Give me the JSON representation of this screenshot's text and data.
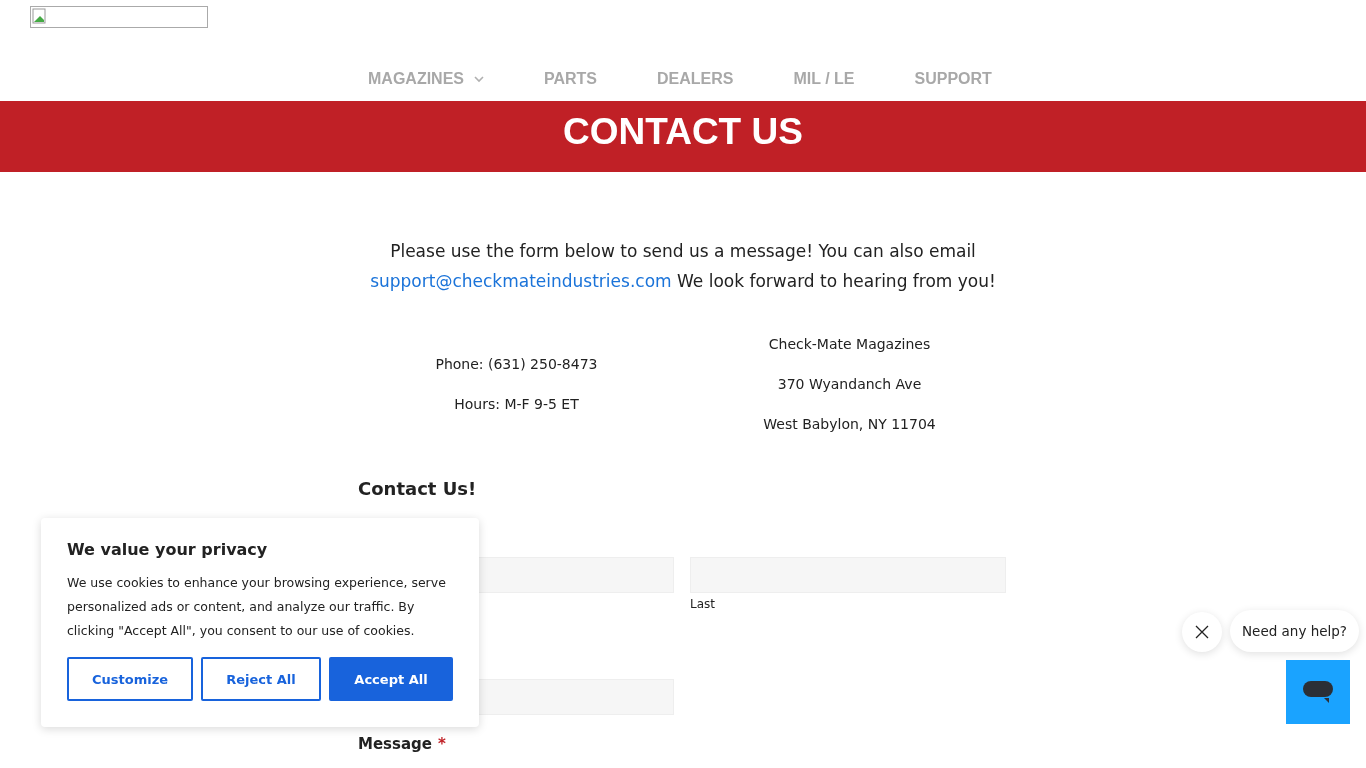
{
  "nav": [
    {
      "label": "MAGAZINES",
      "has_menu": true
    },
    {
      "label": "PARTS",
      "has_menu": false
    },
    {
      "label": "DEALERS",
      "has_menu": false
    },
    {
      "label": "MIL / LE",
      "has_menu": false
    },
    {
      "label": "SUPPORT",
      "has_menu": false
    }
  ],
  "banner": {
    "title": "CONTACT US"
  },
  "intro": {
    "before": "Please use the form below to send us a message! You can also email",
    "email": "support@checkmateindustries.com",
    "after": "We look forward to hearing from you!"
  },
  "contact_left": [
    "Phone: (631) 250-8473",
    "Hours: M-F 9-5 ET"
  ],
  "contact_right": [
    "Check-Mate Magazines",
    "370 Wyandanch Ave",
    "West Babylon, NY 11704"
  ],
  "form": {
    "title": "Contact Us!",
    "last_sublabel": "Last",
    "message_label": "Message",
    "message_required_mark": "*"
  },
  "cookie": {
    "title": "We value your privacy",
    "text": "We use cookies to enhance your browsing experience, serve personalized ads or content, and analyze our traffic. By clicking \"Accept All\", you consent to our use of cookies.",
    "buttons": [
      {
        "label": "Customize",
        "kind": "outline"
      },
      {
        "label": "Reject All",
        "kind": "outline"
      },
      {
        "label": "Accept All",
        "kind": "primary"
      }
    ]
  },
  "chat": {
    "prompt": "Need any help?"
  }
}
